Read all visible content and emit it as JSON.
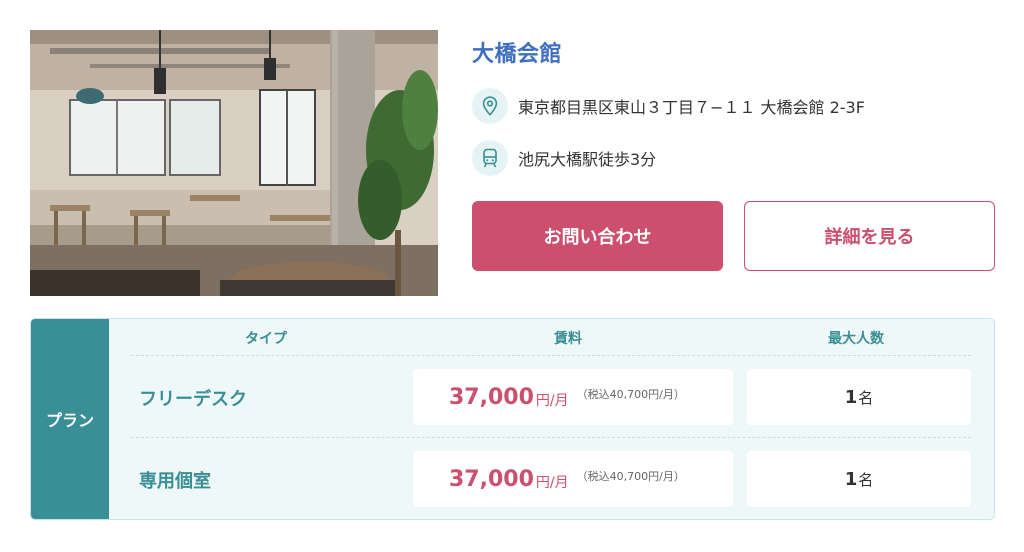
{
  "listing": {
    "name": "大橋会館",
    "address": "東京都目黒区東山３丁目７−１１ 大橋会館 2-3F",
    "access": "池尻大橋駅徒歩3分",
    "icons": {
      "address": "map-pin-icon",
      "access": "train-icon"
    }
  },
  "buttons": {
    "contact": "お問い合わせ",
    "detail": "詳細を見る"
  },
  "plan": {
    "side_label": "プラン",
    "headers": {
      "type": "タイプ",
      "price": "賃料",
      "capacity": "最大人数"
    },
    "rows": [
      {
        "type": "フリーデスク",
        "price": "37,000",
        "price_unit": "円/月",
        "tax_note": "（税込40,700円/月）",
        "capacity": "1",
        "capacity_unit": "名"
      },
      {
        "type": "専用個室",
        "price": "37,000",
        "price_unit": "円/月",
        "tax_note": "（税込40,700円/月）",
        "capacity": "1",
        "capacity_unit": "名"
      }
    ]
  },
  "colors": {
    "title": "#3f6fc0",
    "accent": "#cc4f6e",
    "teal": "#3a8e96",
    "panel": "#eff8f8"
  }
}
